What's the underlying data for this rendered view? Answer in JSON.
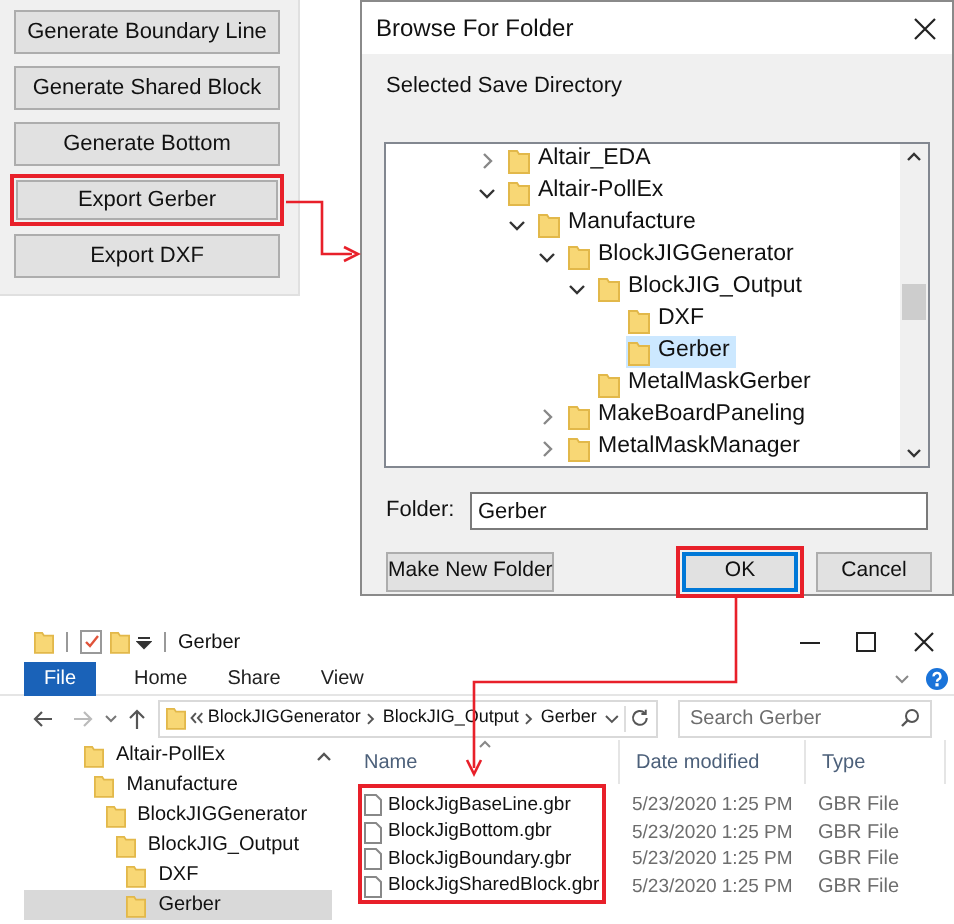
{
  "tool_panel": {
    "buttons": [
      {
        "label": "Generate Boundary Line",
        "highlighted": false
      },
      {
        "label": "Generate Shared Block",
        "highlighted": false
      },
      {
        "label": "Generate Bottom",
        "highlighted": false
      },
      {
        "label": "Export Gerber",
        "highlighted": true
      },
      {
        "label": "Export DXF",
        "highlighted": false
      }
    ]
  },
  "dialog": {
    "title": "Browse For Folder",
    "prompt": "Selected Save Directory",
    "tree": [
      {
        "label": "Altair_EDA",
        "expandable": true,
        "expanded": false,
        "selected": false
      },
      {
        "label": "Altair-PollEx",
        "expandable": true,
        "expanded": true,
        "selected": false,
        "children": [
          {
            "label": "Manufacture",
            "expandable": true,
            "expanded": true,
            "selected": false,
            "children": [
              {
                "label": "BlockJIGGenerator",
                "expandable": true,
                "expanded": true,
                "selected": false,
                "children": [
                  {
                    "label": "BlockJIG_Output",
                    "expandable": true,
                    "expanded": true,
                    "selected": false,
                    "children": [
                      {
                        "label": "DXF",
                        "expandable": false,
                        "selected": false
                      },
                      {
                        "label": "Gerber",
                        "expandable": false,
                        "selected": true
                      }
                    ]
                  },
                  {
                    "label": "MetalMaskGerber",
                    "expandable": false,
                    "selected": false
                  }
                ]
              },
              {
                "label": "MakeBoardPaneling",
                "expandable": true,
                "expanded": false,
                "selected": false
              },
              {
                "label": "MetalMaskManager",
                "expandable": true,
                "expanded": false,
                "selected": false
              }
            ]
          }
        ]
      }
    ],
    "folder_label": "Folder:",
    "folder_value": "Gerber",
    "buttons": [
      {
        "label": "Make New Folder",
        "highlighted": false
      },
      {
        "label": "OK",
        "highlighted": true
      },
      {
        "label": "Cancel",
        "highlighted": false
      }
    ]
  },
  "explorer": {
    "title": "Gerber",
    "ribbon_tabs": [
      {
        "label": "File",
        "kind": "file"
      },
      {
        "label": "Home",
        "kind": "tab"
      },
      {
        "label": "Share",
        "kind": "tab"
      },
      {
        "label": "View",
        "kind": "tab"
      }
    ],
    "address": [
      "BlockJIGGenerator",
      "BlockJIG_Output",
      "Gerber"
    ],
    "search_placeholder": "Search Gerber",
    "nav_tree": [
      {
        "label": "Altair-PollEx",
        "selected": false,
        "children": [
          {
            "label": "Manufacture",
            "selected": false,
            "children": [
              {
                "label": "BlockJIGGenerator",
                "selected": false,
                "children": [
                  {
                    "label": "BlockJIG_Output",
                    "selected": false,
                    "children": [
                      {
                        "label": "DXF",
                        "selected": false
                      },
                      {
                        "label": "Gerber",
                        "selected": true
                      }
                    ]
                  }
                ]
              }
            ]
          }
        ]
      }
    ],
    "columns": [
      "Name",
      "Date modified",
      "Type"
    ],
    "files_highlighted": true,
    "files": [
      {
        "name": "BlockJigBaseLine.gbr",
        "date": "5/23/2020 1:25 PM",
        "type": "GBR File"
      },
      {
        "name": "BlockJigBottom.gbr",
        "date": "5/23/2020 1:25 PM",
        "type": "GBR File"
      },
      {
        "name": "BlockJigBoundary.gbr",
        "date": "5/23/2020 1:25 PM",
        "type": "GBR File"
      },
      {
        "name": "BlockJigSharedBlock.gbr",
        "date": "5/23/2020 1:25 PM",
        "type": "GBR File"
      }
    ]
  }
}
